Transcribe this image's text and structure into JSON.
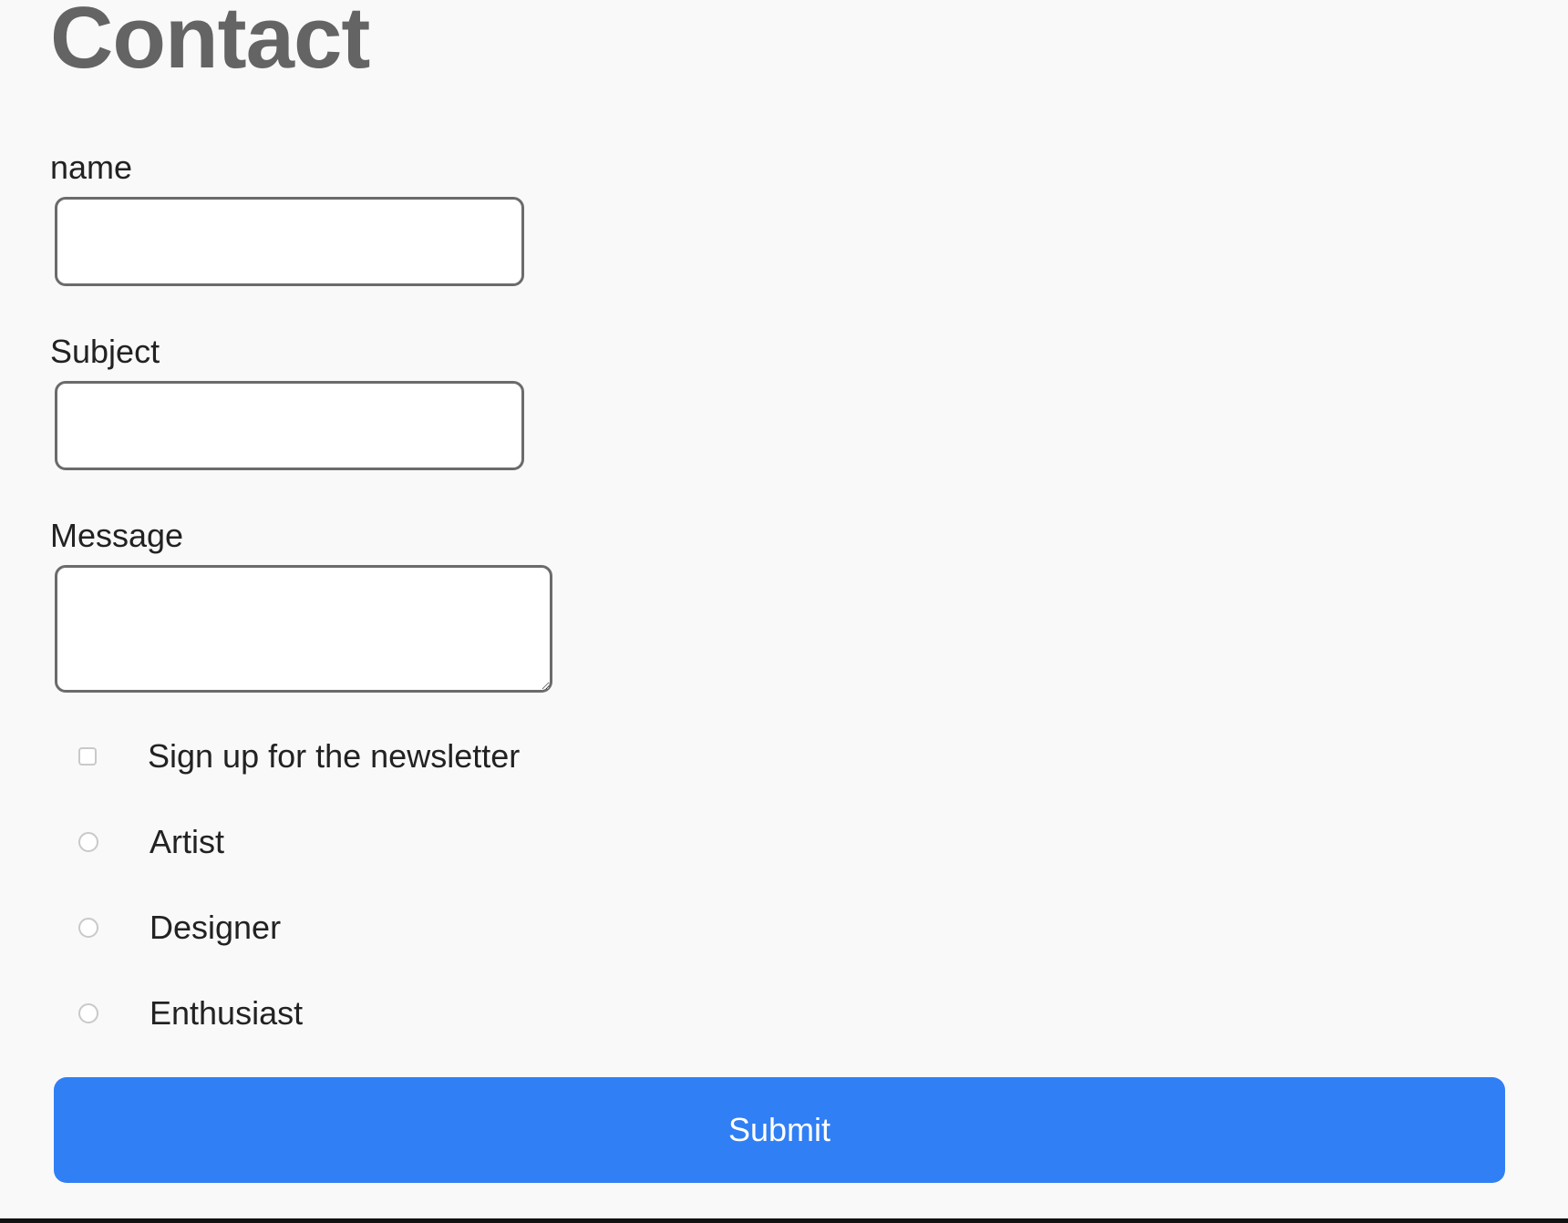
{
  "page": {
    "title": "Contact"
  },
  "form": {
    "name_label": "name",
    "name_value": "",
    "subject_label": "Subject",
    "subject_value": "",
    "message_label": "Message",
    "message_value": "",
    "newsletter_label": "Sign up for the newsletter",
    "newsletter_checked": false,
    "role_options": [
      {
        "label": "Artist",
        "selected": false
      },
      {
        "label": "Designer",
        "selected": false
      },
      {
        "label": "Enthusiast",
        "selected": false
      }
    ],
    "submit_label": "Submit"
  },
  "colors": {
    "background": "#f9f9f9",
    "title": "#646464",
    "input_border": "#6b6b6b",
    "submit_background": "#317ff5",
    "submit_text": "#ffffff"
  }
}
